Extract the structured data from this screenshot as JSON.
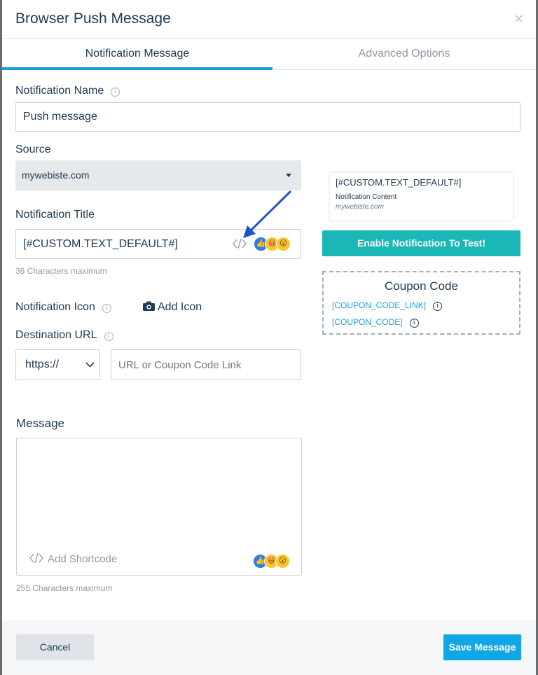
{
  "modal": {
    "title": "Browser Push Message",
    "close_icon": "×"
  },
  "tabs": [
    {
      "label": "Notification Message",
      "active": true
    },
    {
      "label": "Advanced Options",
      "active": false
    }
  ],
  "form": {
    "name_label": "Notification Name",
    "name_value": "Push message",
    "source_label": "Source",
    "source_value": "mywebiste.com",
    "title_label": "Notification Title",
    "title_value": "[#CUSTOM.TEXT_DEFAULT#]",
    "title_hint": "36 Characters maximum",
    "icon_label": "Notification Icon",
    "add_icon_label": "Add Icon",
    "dest_label": "Destination URL",
    "protocol_value": "https://",
    "url_placeholder": "URL or Coupon Code Link",
    "message_label": "Message",
    "add_shortcode_label": "Add Shortcode",
    "message_hint": "255 Characters maximum"
  },
  "preview": {
    "title": "[#CUSTOM.TEXT_DEFAULT#]",
    "content": "Notification Content",
    "domain": "mywebiste.com"
  },
  "test_button": "Enable Notification To Test!",
  "coupon": {
    "title": "Coupon Code",
    "link_code": "[COUPON_CODE_LINK]",
    "code": "[COUPON_CODE]"
  },
  "footer": {
    "cancel": "Cancel",
    "save": "Save Message"
  },
  "colors": {
    "accent": "#1a9fd9",
    "teal": "#1bb6b6",
    "save": "#0fa7e6",
    "arrow": "#1b54c7"
  }
}
